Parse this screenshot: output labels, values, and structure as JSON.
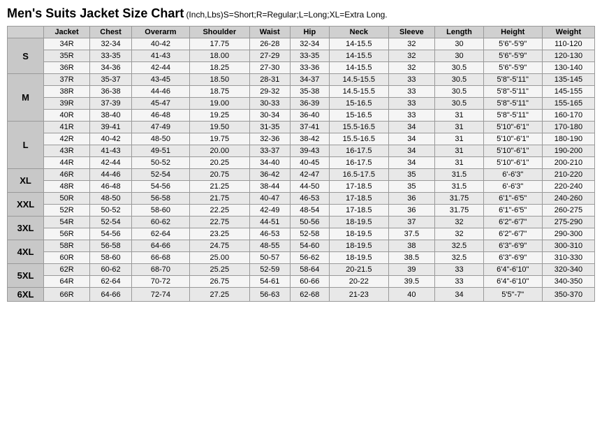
{
  "title": {
    "main": "Men's Suits Jacket Size Chart",
    "sub": "(Inch,Lbs)S=Short;R=Regular;L=Long;XL=Extra Long."
  },
  "columns": [
    "Jacket",
    "Chest",
    "Overarm",
    "Shoulder",
    "Waist",
    "Hip",
    "Neck",
    "Sleeve",
    "Length",
    "Height",
    "Weight"
  ],
  "groups": [
    {
      "label": "S",
      "rows": [
        [
          "34R",
          "32-34",
          "40-42",
          "17.75",
          "26-28",
          "32-34",
          "14-15.5",
          "32",
          "30",
          "5'6\"-5'9\"",
          "110-120"
        ],
        [
          "35R",
          "33-35",
          "41-43",
          "18.00",
          "27-29",
          "33-35",
          "14-15.5",
          "32",
          "30",
          "5'6\"-5'9\"",
          "120-130"
        ],
        [
          "36R",
          "34-36",
          "42-44",
          "18.25",
          "27-30",
          "33-36",
          "14-15.5",
          "32",
          "30.5",
          "5'6\"-5'9\"",
          "130-140"
        ]
      ]
    },
    {
      "label": "M",
      "rows": [
        [
          "37R",
          "35-37",
          "43-45",
          "18.50",
          "28-31",
          "34-37",
          "14.5-15.5",
          "33",
          "30.5",
          "5'8\"-5'11\"",
          "135-145"
        ],
        [
          "38R",
          "36-38",
          "44-46",
          "18.75",
          "29-32",
          "35-38",
          "14.5-15.5",
          "33",
          "30.5",
          "5'8\"-5'11\"",
          "145-155"
        ],
        [
          "39R",
          "37-39",
          "45-47",
          "19.00",
          "30-33",
          "36-39",
          "15-16.5",
          "33",
          "30.5",
          "5'8\"-5'11\"",
          "155-165"
        ],
        [
          "40R",
          "38-40",
          "46-48",
          "19.25",
          "30-34",
          "36-40",
          "15-16.5",
          "33",
          "31",
          "5'8\"-5'11\"",
          "160-170"
        ]
      ]
    },
    {
      "label": "L",
      "rows": [
        [
          "41R",
          "39-41",
          "47-49",
          "19.50",
          "31-35",
          "37-41",
          "15.5-16.5",
          "34",
          "31",
          "5'10\"-6'1\"",
          "170-180"
        ],
        [
          "42R",
          "40-42",
          "48-50",
          "19.75",
          "32-36",
          "38-42",
          "15.5-16.5",
          "34",
          "31",
          "5'10\"-6'1\"",
          "180-190"
        ],
        [
          "43R",
          "41-43",
          "49-51",
          "20.00",
          "33-37",
          "39-43",
          "16-17.5",
          "34",
          "31",
          "5'10\"-6'1\"",
          "190-200"
        ],
        [
          "44R",
          "42-44",
          "50-52",
          "20.25",
          "34-40",
          "40-45",
          "16-17.5",
          "34",
          "31",
          "5'10\"-6'1\"",
          "200-210"
        ]
      ]
    },
    {
      "label": "XL",
      "rows": [
        [
          "46R",
          "44-46",
          "52-54",
          "20.75",
          "36-42",
          "42-47",
          "16.5-17.5",
          "35",
          "31.5",
          "6'-6'3\"",
          "210-220"
        ],
        [
          "48R",
          "46-48",
          "54-56",
          "21.25",
          "38-44",
          "44-50",
          "17-18.5",
          "35",
          "31.5",
          "6'-6'3\"",
          "220-240"
        ]
      ]
    },
    {
      "label": "XXL",
      "rows": [
        [
          "50R",
          "48-50",
          "56-58",
          "21.75",
          "40-47",
          "46-53",
          "17-18.5",
          "36",
          "31.75",
          "6'1\"-6'5\"",
          "240-260"
        ],
        [
          "52R",
          "50-52",
          "58-60",
          "22.25",
          "42-49",
          "48-54",
          "17-18.5",
          "36",
          "31.75",
          "6'1\"-6'5\"",
          "260-275"
        ]
      ]
    },
    {
      "label": "3XL",
      "rows": [
        [
          "54R",
          "52-54",
          "60-62",
          "22.75",
          "44-51",
          "50-56",
          "18-19.5",
          "37",
          "32",
          "6'2\"-6'7\"",
          "275-290"
        ],
        [
          "56R",
          "54-56",
          "62-64",
          "23.25",
          "46-53",
          "52-58",
          "18-19.5",
          "37.5",
          "32",
          "6'2\"-6'7\"",
          "290-300"
        ]
      ]
    },
    {
      "label": "4XL",
      "rows": [
        [
          "58R",
          "56-58",
          "64-66",
          "24.75",
          "48-55",
          "54-60",
          "18-19.5",
          "38",
          "32.5",
          "6'3\"-6'9\"",
          "300-310"
        ],
        [
          "60R",
          "58-60",
          "66-68",
          "25.00",
          "50-57",
          "56-62",
          "18-19.5",
          "38.5",
          "32.5",
          "6'3\"-6'9\"",
          "310-330"
        ]
      ]
    },
    {
      "label": "5XL",
      "rows": [
        [
          "62R",
          "60-62",
          "68-70",
          "25.25",
          "52-59",
          "58-64",
          "20-21.5",
          "39",
          "33",
          "6'4\"-6'10\"",
          "320-340"
        ],
        [
          "64R",
          "62-64",
          "70-72",
          "26.75",
          "54-61",
          "60-66",
          "20-22",
          "39.5",
          "33",
          "6'4\"-6'10\"",
          "340-350"
        ]
      ]
    },
    {
      "label": "6XL",
      "rows": [
        [
          "66R",
          "64-66",
          "72-74",
          "27.25",
          "56-63",
          "62-68",
          "21-23",
          "40",
          "34",
          "5'5\"-7\"",
          "350-370"
        ]
      ]
    }
  ]
}
